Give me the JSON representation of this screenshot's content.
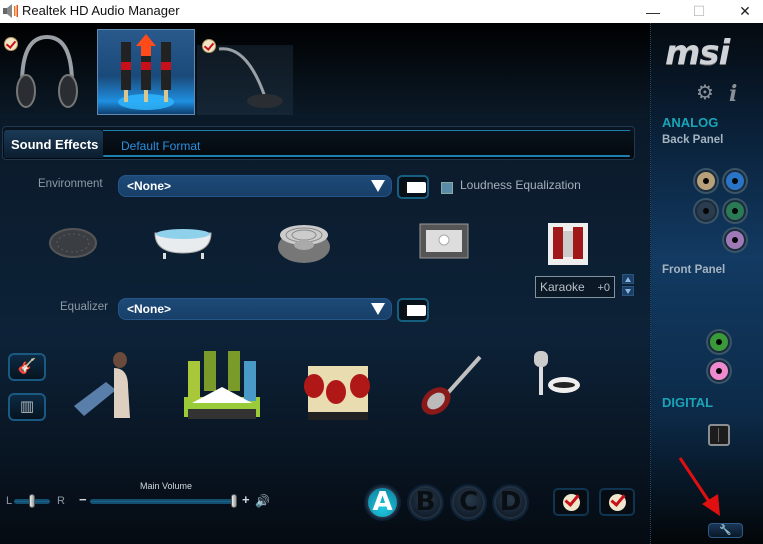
{
  "window": {
    "title": "Realtek HD Audio Manager",
    "minimize_label": "—",
    "maximize_label": "☐",
    "close_label": "✕"
  },
  "devices": [
    {
      "name": "Headphones",
      "icon": "headphones-icon",
      "selected": false,
      "enabled": true
    },
    {
      "name": "Speakers",
      "icon": "speakers-rca-icon",
      "selected": true,
      "enabled": true
    },
    {
      "name": "Microphone",
      "icon": "microphone-icon",
      "selected": false,
      "enabled": true
    }
  ],
  "tabs": [
    {
      "label": "Sound Effects",
      "active": true
    },
    {
      "label": "Default Format",
      "active": false
    }
  ],
  "sound_effects": {
    "environment_label": "Environment",
    "environment_value": "<None>",
    "loudness_label": "Loudness Equalization",
    "loudness_checked": false,
    "environment_presets": [
      "sewer-pipe",
      "bathroom",
      "stone-corridor",
      "room",
      "theater"
    ],
    "equalizer_label": "Equalizer",
    "equalizer_value": "<None>",
    "equalizer_presets": [
      "pop",
      "live",
      "lounge",
      "rock"
    ],
    "side_buttons": [
      "guitar-icon",
      "equalizer-graph-icon"
    ],
    "karaoke_label": "Karaoke",
    "karaoke_value": "+0"
  },
  "volume": {
    "balance_left": "L",
    "balance_right": "R",
    "balance_position": 0.5,
    "main_label": "Main Volume",
    "minus": "−",
    "plus": "+",
    "main_level": 1.0
  },
  "profiles": [
    {
      "label": "A",
      "active": true
    },
    {
      "label": "B",
      "active": false
    },
    {
      "label": "C",
      "active": false
    },
    {
      "label": "D",
      "active": false
    }
  ],
  "right_panel": {
    "brand": "msi",
    "settings_icon": "gear-icon",
    "info_label": "i",
    "analog_label": "ANALOG",
    "back_panel_label": "Back Panel",
    "front_panel_label": "Front Panel",
    "digital_label": "DIGITAL",
    "back_jacks": [
      {
        "name": "line-in",
        "color": "#b8a07a"
      },
      {
        "name": "line-out",
        "color": "#2a74c8"
      },
      {
        "name": "rear",
        "color": "#2a3c4e"
      },
      {
        "name": "center-sub",
        "color": "#2a7a56"
      },
      {
        "name": "mic-in",
        "color": "#a07ab8"
      }
    ],
    "front_jacks": [
      {
        "name": "headphone-out",
        "color": "#3a9a3a"
      },
      {
        "name": "mic-in",
        "color": "#f08ad0"
      }
    ],
    "wrench_label": "🔧"
  }
}
